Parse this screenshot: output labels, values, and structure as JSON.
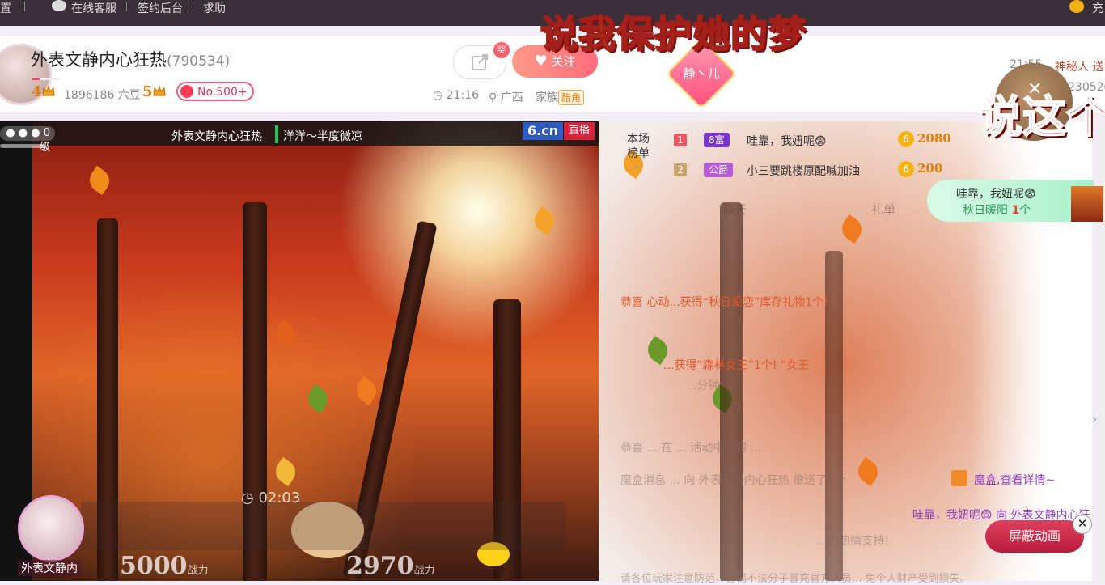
{
  "topbar": {
    "item_left": "置",
    "service": "在线客服",
    "sign_backend": "签约后台",
    "help": "求助",
    "right": "充"
  },
  "anchor": {
    "name": "外表文静内心狂热",
    "room_id": "(790534)",
    "level_left": "4",
    "beans": "1896186 六豆",
    "level_right": "5",
    "rank": "No.500+",
    "level_progress": 0.25
  },
  "actions": {
    "share_badge": "奖",
    "follow": "关注"
  },
  "meta": {
    "time": "21:16",
    "location": "广西",
    "family_label": "家族",
    "family_tag": "醋角"
  },
  "overlay": {
    "caption_top": "说我保护她的梦",
    "caption_right": "说这个",
    "heart_pin": "静丶儿",
    "right_time": "21:55",
    "right_text": "神秘人 送",
    "right_id": "230520"
  },
  "video": {
    "viewer_level": "0级",
    "streamer_name": "外表文静内心狂热",
    "song": "洋洋～半度微凉",
    "logo": "6.cn",
    "live": "直播",
    "timer": "02:03",
    "pk_left_score": "5000",
    "pk_right_score": "2970",
    "pk_unit": "战力",
    "pk_name": "外表文静内"
  },
  "rank_board": {
    "title": "本场榜单",
    "rows": [
      {
        "num": "1",
        "badge": "8富",
        "name": "哇靠，我妞呢😨",
        "value": "2080"
      },
      {
        "num": "2",
        "badge": "公爵",
        "name": "小三要跳楼原配喊加油",
        "value": "200"
      }
    ]
  },
  "gift_popup": {
    "line1": "哇靠，我妞呢😨",
    "sender": "秋日暖阳",
    "count": "1",
    "unit": "个"
  },
  "chat_tabs": [
    "聊天",
    "礼单"
  ],
  "chat": [
    {
      "text": "恭喜 心动...获得“秋日爱恋”库存礼物1个!",
      "style": "red"
    },
    {
      "text": "...获得“森林女王”1个! “女王",
      "style": "red"
    },
    {
      "text": "...分钟!",
      "style": "faded"
    },
    {
      "text": "恭喜 ... 在 ... 活动中获得 ...",
      "style": "faded"
    },
    {
      "text": "魔盒消息 ... 向 外表文静内心狂热 赠送了1个",
      "style": "faded"
    },
    {
      "text": "魔盒,查看详情~",
      "style": "purple"
    },
    {
      "text": "哇靠，我妞呢😨 向 外表文静内心狂",
      "style": "purple"
    },
    {
      "text": "...的热情支持!",
      "style": "faded"
    },
    {
      "text": "请各位玩家注意防范，警惕不法分子冒充官方人员... 免个人财产受到损失。",
      "style": "faded"
    }
  ],
  "controls": {
    "shield_animation": "屏蔽动画",
    "close": "✕"
  },
  "colors": {
    "accent": "#e54d6b",
    "follow": "#ff6c7a",
    "live": "#d9203d",
    "rank_gold": "#e67f00"
  }
}
